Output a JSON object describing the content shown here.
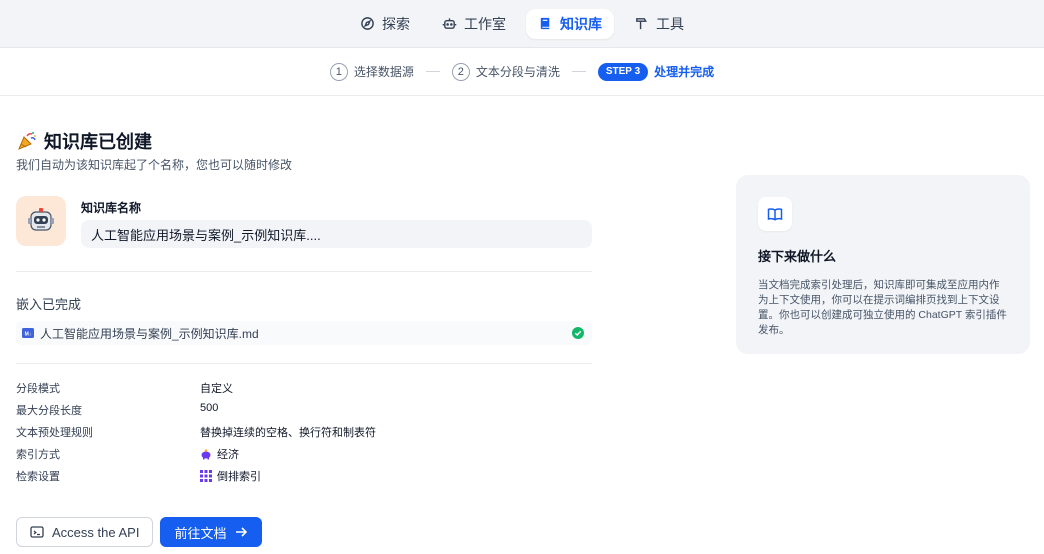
{
  "nav": {
    "items": [
      {
        "label": "探索",
        "icon": "compass-icon"
      },
      {
        "label": "工作室",
        "icon": "robot-icon"
      },
      {
        "label": "知识库",
        "icon": "book-icon",
        "active": true
      },
      {
        "label": "工具",
        "icon": "hammer-icon"
      }
    ]
  },
  "stepper": {
    "step1": {
      "num": "1",
      "label": "选择数据源"
    },
    "step2": {
      "num": "2",
      "label": "文本分段与清洗"
    },
    "step3": {
      "badge": "STEP 3",
      "label": "处理并完成"
    }
  },
  "main": {
    "title": "知识库已创建",
    "subtitle": "我们自动为该知识库起了个名称，您也可以随时修改",
    "kb_name_label": "知识库名称",
    "kb_name_value": "人工智能应用场景与案例_示例知识库....",
    "embed_title": "嵌入已完成",
    "file_name": "人工智能应用场景与案例_示例知识库.md",
    "props": [
      {
        "key": "分段模式",
        "value": "自定义"
      },
      {
        "key": "最大分段长度",
        "value": "500"
      },
      {
        "key": "文本预处理规则",
        "value": "替换掉连续的空格、换行符和制表符"
      },
      {
        "key": "索引方式",
        "value": "经济"
      },
      {
        "key": "检索设置",
        "value": "倒排索引"
      }
    ],
    "api_button": "Access the API",
    "docs_button": "前往文档"
  },
  "next": {
    "title": "接下来做什么",
    "description": "当文档完成索引处理后，知识库即可集成至应用内作为上下文使用，你可以在提示词编排页找到上下文设置。你也可以创建成可独立使用的 ChatGPT 索引插件发布。"
  },
  "colors": {
    "accent": "#155eef",
    "success": "#12b76a"
  }
}
